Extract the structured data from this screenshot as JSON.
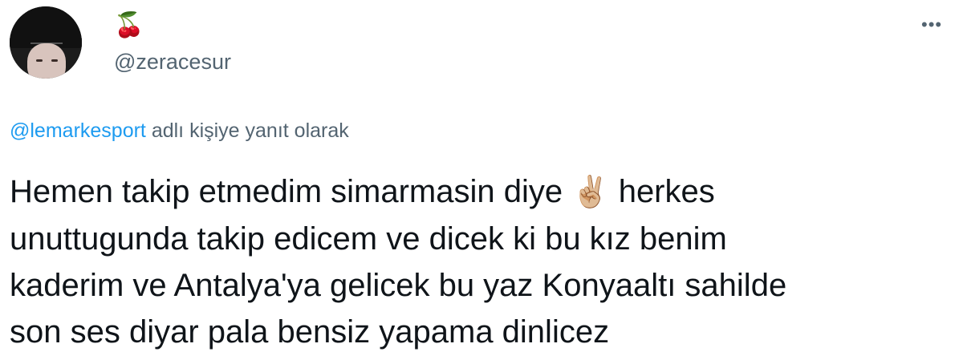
{
  "author": {
    "display_name": "🍒",
    "handle": "@zeracesur"
  },
  "reply": {
    "mention": "@lemarkesport",
    "suffix": " adlı kişiye yanıt olarak"
  },
  "tweet": {
    "lines": [
      "Hemen takip etmedim simarmasin diye",
      "unuttugunda takip edicem ve dicek ki bu kız benim",
      "kaderim ve Antalya'ya gelicek bu yaz Konyaaltı sahilde",
      "son ses diyar pala bensiz yapama dinlicez"
    ],
    "emoji": "✌🏼",
    "line1_end": " herkes"
  },
  "menu": {
    "more_label": "•••"
  }
}
